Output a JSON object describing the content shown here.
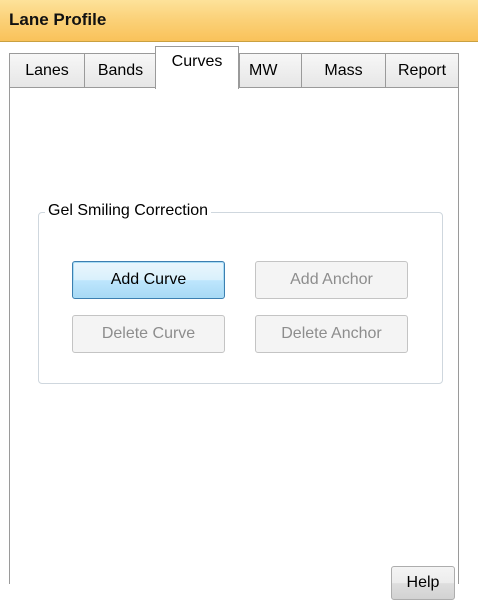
{
  "titlebar": {
    "title": "Lane Profile"
  },
  "tabs": [
    {
      "label": "Lanes",
      "active": false
    },
    {
      "label": "Bands",
      "active": false
    },
    {
      "label": "Curves",
      "active": true
    },
    {
      "label": "MW",
      "active": false
    },
    {
      "label": "Mass",
      "active": false
    },
    {
      "label": "Report",
      "active": false
    }
  ],
  "gel_smiling": {
    "legend": "Gel Smiling Correction",
    "add_curve": {
      "label": "Add Curve",
      "enabled": true,
      "focused": true
    },
    "add_anchor": {
      "label": "Add Anchor",
      "enabled": false
    },
    "delete_curve": {
      "label": "Delete Curve",
      "enabled": false
    },
    "delete_anchor": {
      "label": "Delete Anchor",
      "enabled": false
    }
  },
  "help": {
    "label": "Help"
  },
  "colors": {
    "titlebar_top": "#fde29a",
    "titlebar_bottom": "#f9c25a",
    "focus_border": "#3c7fb1",
    "disabled_text": "#8d8d8d"
  }
}
